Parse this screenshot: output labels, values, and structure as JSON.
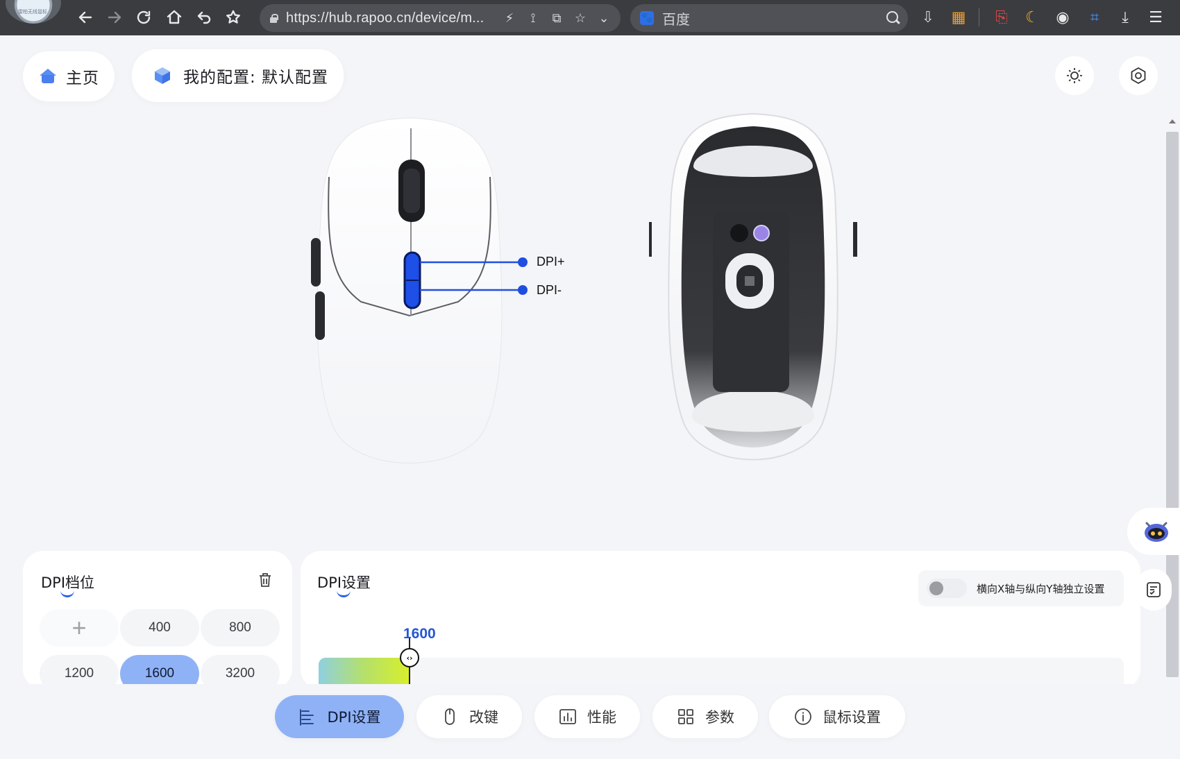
{
  "browser": {
    "url": "https://hub.rapoo.cn/device/m...",
    "search_engine": "百度",
    "avatar_text": "雷柏无线鼠标"
  },
  "header": {
    "home_label": "主页",
    "config_label": "我的配置: 默认配置"
  },
  "mouse": {
    "callout_dpi_up": "DPI+",
    "callout_dpi_down": "DPI-"
  },
  "dpi_levels_panel": {
    "title": "DPI档位",
    "add_label": "+",
    "levels": [
      "400",
      "800",
      "1200",
      "1600",
      "3200"
    ],
    "active_level": "1600"
  },
  "dpi_settings_panel": {
    "title": "DPI设置",
    "xy_toggle_label": "横向X轴与纵向Y轴独立设置",
    "xy_toggle_on": false,
    "slider_value": "1600",
    "handle_glyph": "‹›"
  },
  "tabs": [
    {
      "label": "DPI设置",
      "icon": "dpi-settings-icon",
      "active": true
    },
    {
      "label": "改键",
      "icon": "mouse-icon",
      "active": false
    },
    {
      "label": "性能",
      "icon": "chart-icon",
      "active": false
    },
    {
      "label": "参数",
      "icon": "grid-icon",
      "active": false
    },
    {
      "label": "鼠标设置",
      "icon": "info-icon",
      "active": false
    }
  ],
  "colors": {
    "accent": "#2a62e8",
    "active_tab": "#8fb2f6",
    "dpi_line": "#1f4fe0"
  }
}
